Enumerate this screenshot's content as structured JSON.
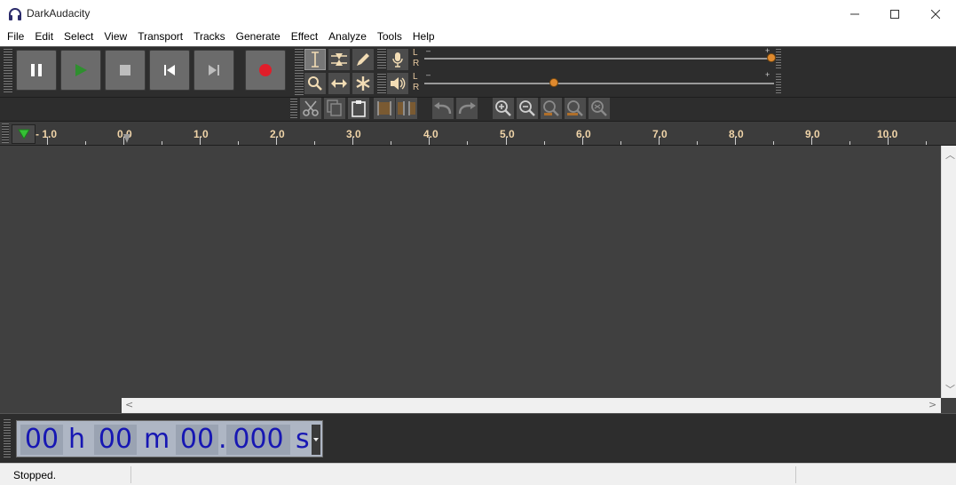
{
  "window": {
    "title": "DarkAudacity"
  },
  "menu": [
    "File",
    "Edit",
    "Select",
    "View",
    "Transport",
    "Tracks",
    "Generate",
    "Effect",
    "Analyze",
    "Tools",
    "Help"
  ],
  "meters": {
    "record": {
      "left_label": "L",
      "right_label": "R",
      "minus": "–",
      "plus": "+"
    },
    "playback": {
      "left_label": "L",
      "right_label": "R",
      "minus": "–",
      "plus": "+"
    }
  },
  "ruler": {
    "labels": [
      "- 1.0",
      "0.0",
      "1.0",
      "2.0",
      "3.0",
      "4.0",
      "5.0",
      "6.0",
      "7.0",
      "8.0",
      "9.0",
      "10.0"
    ]
  },
  "time_text": {
    "hours": "00",
    "h": "h",
    "minutes": "00",
    "m": "m",
    "seconds": "00",
    "dot": ".",
    "millis": "000",
    "s": "s"
  },
  "status": {
    "text": "Stopped."
  },
  "colors": {
    "accent": "#e08a2e",
    "digits": "#1717b3",
    "ruler_text": "#f0d4a8"
  }
}
